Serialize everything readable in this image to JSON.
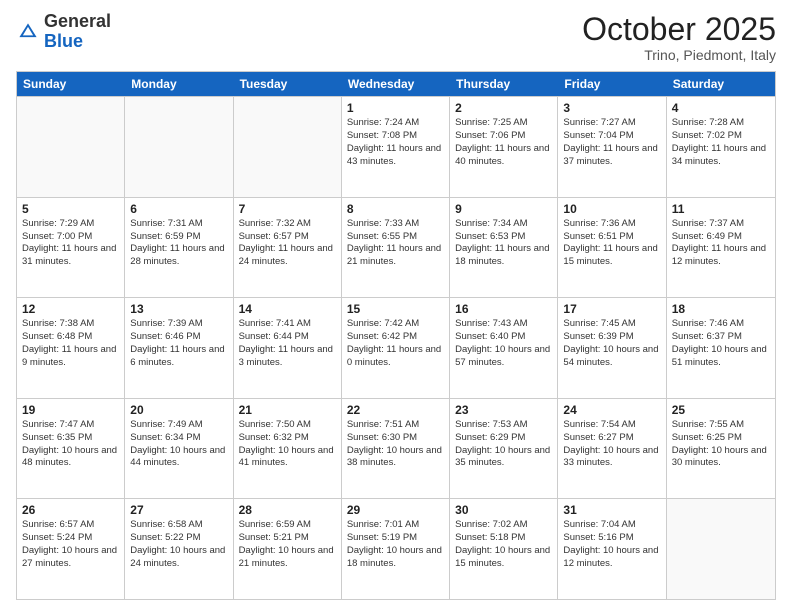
{
  "logo": {
    "general": "General",
    "blue": "Blue"
  },
  "header": {
    "month": "October 2025",
    "location": "Trino, Piedmont, Italy"
  },
  "days": [
    "Sunday",
    "Monday",
    "Tuesday",
    "Wednesday",
    "Thursday",
    "Friday",
    "Saturday"
  ],
  "weeks": [
    [
      {
        "day": "",
        "text": ""
      },
      {
        "day": "",
        "text": ""
      },
      {
        "day": "",
        "text": ""
      },
      {
        "day": "1",
        "text": "Sunrise: 7:24 AM\nSunset: 7:08 PM\nDaylight: 11 hours and 43 minutes."
      },
      {
        "day": "2",
        "text": "Sunrise: 7:25 AM\nSunset: 7:06 PM\nDaylight: 11 hours and 40 minutes."
      },
      {
        "day": "3",
        "text": "Sunrise: 7:27 AM\nSunset: 7:04 PM\nDaylight: 11 hours and 37 minutes."
      },
      {
        "day": "4",
        "text": "Sunrise: 7:28 AM\nSunset: 7:02 PM\nDaylight: 11 hours and 34 minutes."
      }
    ],
    [
      {
        "day": "5",
        "text": "Sunrise: 7:29 AM\nSunset: 7:00 PM\nDaylight: 11 hours and 31 minutes."
      },
      {
        "day": "6",
        "text": "Sunrise: 7:31 AM\nSunset: 6:59 PM\nDaylight: 11 hours and 28 minutes."
      },
      {
        "day": "7",
        "text": "Sunrise: 7:32 AM\nSunset: 6:57 PM\nDaylight: 11 hours and 24 minutes."
      },
      {
        "day": "8",
        "text": "Sunrise: 7:33 AM\nSunset: 6:55 PM\nDaylight: 11 hours and 21 minutes."
      },
      {
        "day": "9",
        "text": "Sunrise: 7:34 AM\nSunset: 6:53 PM\nDaylight: 11 hours and 18 minutes."
      },
      {
        "day": "10",
        "text": "Sunrise: 7:36 AM\nSunset: 6:51 PM\nDaylight: 11 hours and 15 minutes."
      },
      {
        "day": "11",
        "text": "Sunrise: 7:37 AM\nSunset: 6:49 PM\nDaylight: 11 hours and 12 minutes."
      }
    ],
    [
      {
        "day": "12",
        "text": "Sunrise: 7:38 AM\nSunset: 6:48 PM\nDaylight: 11 hours and 9 minutes."
      },
      {
        "day": "13",
        "text": "Sunrise: 7:39 AM\nSunset: 6:46 PM\nDaylight: 11 hours and 6 minutes."
      },
      {
        "day": "14",
        "text": "Sunrise: 7:41 AM\nSunset: 6:44 PM\nDaylight: 11 hours and 3 minutes."
      },
      {
        "day": "15",
        "text": "Sunrise: 7:42 AM\nSunset: 6:42 PM\nDaylight: 11 hours and 0 minutes."
      },
      {
        "day": "16",
        "text": "Sunrise: 7:43 AM\nSunset: 6:40 PM\nDaylight: 10 hours and 57 minutes."
      },
      {
        "day": "17",
        "text": "Sunrise: 7:45 AM\nSunset: 6:39 PM\nDaylight: 10 hours and 54 minutes."
      },
      {
        "day": "18",
        "text": "Sunrise: 7:46 AM\nSunset: 6:37 PM\nDaylight: 10 hours and 51 minutes."
      }
    ],
    [
      {
        "day": "19",
        "text": "Sunrise: 7:47 AM\nSunset: 6:35 PM\nDaylight: 10 hours and 48 minutes."
      },
      {
        "day": "20",
        "text": "Sunrise: 7:49 AM\nSunset: 6:34 PM\nDaylight: 10 hours and 44 minutes."
      },
      {
        "day": "21",
        "text": "Sunrise: 7:50 AM\nSunset: 6:32 PM\nDaylight: 10 hours and 41 minutes."
      },
      {
        "day": "22",
        "text": "Sunrise: 7:51 AM\nSunset: 6:30 PM\nDaylight: 10 hours and 38 minutes."
      },
      {
        "day": "23",
        "text": "Sunrise: 7:53 AM\nSunset: 6:29 PM\nDaylight: 10 hours and 35 minutes."
      },
      {
        "day": "24",
        "text": "Sunrise: 7:54 AM\nSunset: 6:27 PM\nDaylight: 10 hours and 33 minutes."
      },
      {
        "day": "25",
        "text": "Sunrise: 7:55 AM\nSunset: 6:25 PM\nDaylight: 10 hours and 30 minutes."
      }
    ],
    [
      {
        "day": "26",
        "text": "Sunrise: 6:57 AM\nSunset: 5:24 PM\nDaylight: 10 hours and 27 minutes."
      },
      {
        "day": "27",
        "text": "Sunrise: 6:58 AM\nSunset: 5:22 PM\nDaylight: 10 hours and 24 minutes."
      },
      {
        "day": "28",
        "text": "Sunrise: 6:59 AM\nSunset: 5:21 PM\nDaylight: 10 hours and 21 minutes."
      },
      {
        "day": "29",
        "text": "Sunrise: 7:01 AM\nSunset: 5:19 PM\nDaylight: 10 hours and 18 minutes."
      },
      {
        "day": "30",
        "text": "Sunrise: 7:02 AM\nSunset: 5:18 PM\nDaylight: 10 hours and 15 minutes."
      },
      {
        "day": "31",
        "text": "Sunrise: 7:04 AM\nSunset: 5:16 PM\nDaylight: 10 hours and 12 minutes."
      },
      {
        "day": "",
        "text": ""
      }
    ]
  ]
}
